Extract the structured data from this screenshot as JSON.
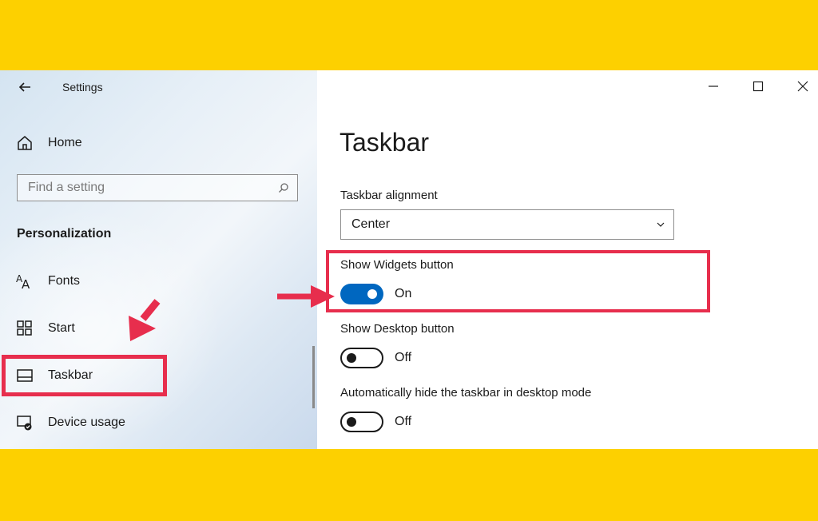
{
  "window": {
    "title": "Settings"
  },
  "sidebar": {
    "home_label": "Home",
    "search_placeholder": "Find a setting",
    "section_heading": "Personalization",
    "items": [
      {
        "label": "Fonts",
        "icon": "fonts-icon"
      },
      {
        "label": "Start",
        "icon": "start-grid-icon"
      },
      {
        "label": "Taskbar",
        "icon": "taskbar-icon",
        "selected": true
      },
      {
        "label": "Device usage",
        "icon": "device-usage-icon"
      }
    ]
  },
  "main": {
    "page_title": "Taskbar",
    "alignment": {
      "label": "Taskbar alignment",
      "value": "Center"
    },
    "settings": [
      {
        "label": "Show Widgets button",
        "state": "On"
      },
      {
        "label": "Show Desktop button",
        "state": "Off"
      },
      {
        "label": "Automatically hide the taskbar in desktop mode",
        "state": "Off"
      }
    ]
  },
  "colors": {
    "background_band": "#fdd000",
    "annotation": "#e72e4d",
    "toggle_on": "#0067c0"
  }
}
